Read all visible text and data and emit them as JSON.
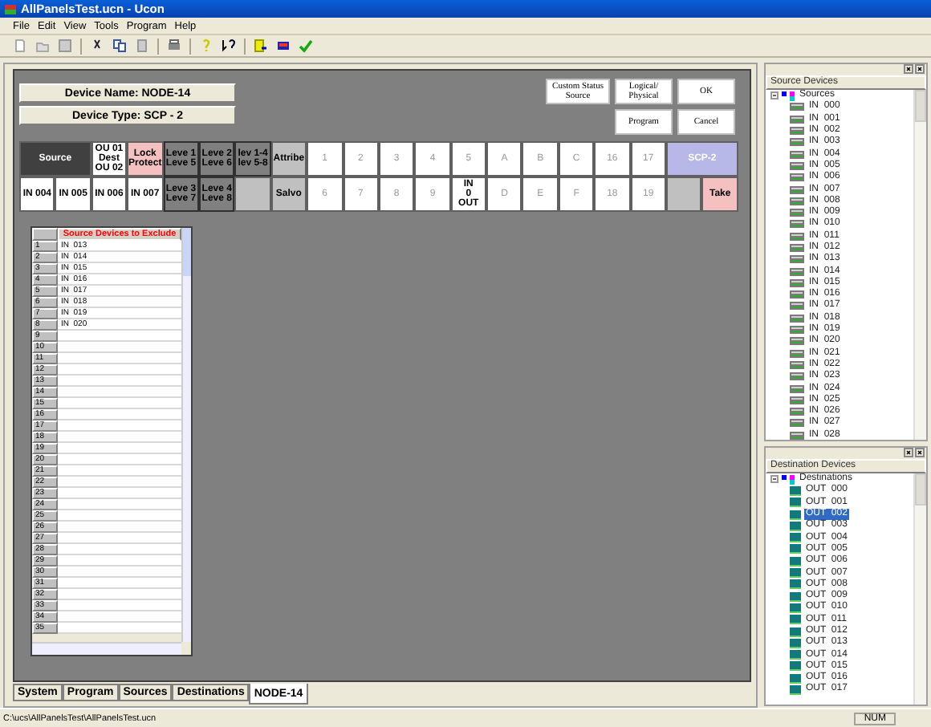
{
  "window": {
    "title": "AllPanelsTest.ucn - Ucon"
  },
  "menu": [
    "File",
    "Edit",
    "View",
    "Tools",
    "Program",
    "Help"
  ],
  "device": {
    "name": "Device Name: NODE-14",
    "type": "Device Type: SCP - 2"
  },
  "panel_buttons": [
    {
      "lines": [
        "Custom Status",
        "Source"
      ]
    },
    {
      "lines": [
        "Logical/",
        "Physical"
      ]
    },
    {
      "lines": [
        "OK"
      ]
    },
    {
      "lines": [
        "Program"
      ]
    },
    {
      "lines": [
        "Cancel"
      ]
    }
  ],
  "grid_rows": [
    [
      {
        "kind": "dark",
        "lines": [
          "Source"
        ]
      },
      {
        "kind": "white",
        "lines": [
          "OU 01",
          "Dest",
          "OU 02"
        ]
      },
      {
        "kind": "pink",
        "lines": [
          "Lock",
          "Protect"
        ]
      },
      {
        "kind": "level",
        "lines": [
          "Leve 1",
          "Leve 5"
        ]
      },
      {
        "kind": "level",
        "lines": [
          "Leve 2",
          "Leve 6"
        ]
      },
      {
        "kind": "level",
        "lines": [
          "lev 1-4",
          "lev 5-8"
        ]
      },
      {
        "kind": "action",
        "lines": [
          "Attribe"
        ]
      },
      {
        "kind": "key",
        "lines": [
          "1"
        ]
      },
      {
        "kind": "key",
        "lines": [
          "2"
        ]
      },
      {
        "kind": "key",
        "lines": [
          "3"
        ]
      },
      {
        "kind": "key",
        "lines": [
          "4"
        ]
      },
      {
        "kind": "key",
        "lines": [
          "5"
        ]
      },
      {
        "kind": "key",
        "lines": [
          "A"
        ]
      },
      {
        "kind": "key",
        "lines": [
          "B"
        ]
      },
      {
        "kind": "key",
        "lines": [
          "C"
        ]
      },
      {
        "kind": "key",
        "lines": [
          "16"
        ]
      },
      {
        "kind": "key",
        "lines": [
          "17"
        ]
      },
      {
        "kind": "device",
        "lines": [
          "SCP-2"
        ]
      }
    ],
    [
      {
        "kind": "white",
        "lines": [
          "IN 004"
        ]
      },
      {
        "kind": "white",
        "lines": [
          "IN 005"
        ]
      },
      {
        "kind": "white",
        "lines": [
          "IN 006"
        ]
      },
      {
        "kind": "white",
        "lines": [
          "IN 007"
        ]
      },
      {
        "kind": "level",
        "lines": [
          "Leve 3",
          "Leve 7"
        ]
      },
      {
        "kind": "level",
        "lines": [
          "Leve 4",
          "Leve 8"
        ]
      },
      {
        "kind": "blank"
      },
      {
        "kind": "action",
        "lines": [
          "Salvo"
        ]
      },
      {
        "kind": "key",
        "lines": [
          "6"
        ]
      },
      {
        "kind": "key",
        "lines": [
          "7"
        ]
      },
      {
        "kind": "key",
        "lines": [
          "8"
        ]
      },
      {
        "kind": "key",
        "lines": [
          "9"
        ]
      },
      {
        "kind": "white",
        "lines": [
          "IN",
          "0",
          "OUT"
        ]
      },
      {
        "kind": "key",
        "lines": [
          "D"
        ]
      },
      {
        "kind": "key",
        "lines": [
          "E"
        ]
      },
      {
        "kind": "key",
        "lines": [
          "F"
        ]
      },
      {
        "kind": "key",
        "lines": [
          "18"
        ]
      },
      {
        "kind": "key",
        "lines": [
          "19"
        ]
      },
      {
        "kind": "blank"
      },
      {
        "kind": "pink",
        "lines": [
          "Take"
        ]
      }
    ]
  ],
  "exclude_table": {
    "header": "Source Devices to Exclude",
    "rows": [
      {
        "number": "1",
        "value": "IN  013"
      },
      {
        "number": "2",
        "value": "IN  014"
      },
      {
        "number": "3",
        "value": "IN  015"
      },
      {
        "number": "4",
        "value": "IN  016"
      },
      {
        "number": "5",
        "value": "IN  017"
      },
      {
        "number": "6",
        "value": "IN  018"
      },
      {
        "number": "7",
        "value": "IN  019"
      },
      {
        "number": "8",
        "value": "IN  020"
      },
      {
        "number": "9"
      },
      {
        "number": "10"
      },
      {
        "number": "11"
      },
      {
        "number": "12"
      },
      {
        "number": "13"
      },
      {
        "number": "14"
      },
      {
        "number": "15"
      },
      {
        "number": "16"
      },
      {
        "number": "17"
      },
      {
        "number": "18"
      },
      {
        "number": "19"
      },
      {
        "number": "20"
      },
      {
        "number": "21"
      },
      {
        "number": "22"
      },
      {
        "number": "23"
      },
      {
        "number": "24"
      },
      {
        "number": "25"
      },
      {
        "number": "26"
      },
      {
        "number": "27"
      },
      {
        "number": "28"
      },
      {
        "number": "29"
      },
      {
        "number": "30"
      },
      {
        "number": "31"
      },
      {
        "number": "32"
      },
      {
        "number": "33"
      },
      {
        "number": "34"
      },
      {
        "number": "35"
      }
    ]
  },
  "doc_tabs": [
    {
      "label": "System",
      "selected": false
    },
    {
      "label": "Program",
      "selected": false
    },
    {
      "label": "Sources",
      "selected": false
    },
    {
      "label": "Destinations",
      "selected": false
    },
    {
      "label": "NODE-14",
      "selected": true
    }
  ],
  "source_panel": {
    "header": "Source Devices",
    "root": "Sources",
    "kind": "in",
    "items": [
      {
        "label": "IN  000",
        "selected": false
      },
      {
        "label": "IN  001",
        "selected": false
      },
      {
        "label": "IN  002",
        "selected": false
      },
      {
        "label": "IN  003",
        "selected": false
      },
      {
        "label": "IN  004",
        "selected": false
      },
      {
        "label": "IN  005",
        "selected": false
      },
      {
        "label": "IN  006",
        "selected": false
      },
      {
        "label": "IN  007",
        "selected": false
      },
      {
        "label": "IN  008",
        "selected": false
      },
      {
        "label": "IN  009",
        "selected": false
      },
      {
        "label": "IN  010",
        "selected": false
      },
      {
        "label": "IN  011",
        "selected": false
      },
      {
        "label": "IN  012",
        "selected": false
      },
      {
        "label": "IN  013",
        "selected": false
      },
      {
        "label": "IN  014",
        "selected": false
      },
      {
        "label": "IN  015",
        "selected": false
      },
      {
        "label": "IN  016",
        "selected": false
      },
      {
        "label": "IN  017",
        "selected": false
      },
      {
        "label": "IN  018",
        "selected": false
      },
      {
        "label": "IN  019",
        "selected": false
      },
      {
        "label": "IN  020",
        "selected": false
      },
      {
        "label": "IN  021",
        "selected": false
      },
      {
        "label": "IN  022",
        "selected": false
      },
      {
        "label": "IN  023",
        "selected": false
      },
      {
        "label": "IN  024",
        "selected": false
      },
      {
        "label": "IN  025",
        "selected": false
      },
      {
        "label": "IN  026",
        "selected": false
      },
      {
        "label": "IN  027",
        "selected": false
      },
      {
        "label": "IN  028",
        "selected": false
      }
    ]
  },
  "destination_panel": {
    "header": "Destination Devices",
    "root": "Destinations",
    "kind": "out",
    "items": [
      {
        "label": "OUT  000",
        "selected": false
      },
      {
        "label": "OUT  001",
        "selected": false
      },
      {
        "label": "OUT  002",
        "selected": true
      },
      {
        "label": "OUT  003",
        "selected": false
      },
      {
        "label": "OUT  004",
        "selected": false
      },
      {
        "label": "OUT  005",
        "selected": false
      },
      {
        "label": "OUT  006",
        "selected": false
      },
      {
        "label": "OUT  007",
        "selected": false
      },
      {
        "label": "OUT  008",
        "selected": false
      },
      {
        "label": "OUT  009",
        "selected": false
      },
      {
        "label": "OUT  010",
        "selected": false
      },
      {
        "label": "OUT  011",
        "selected": false
      },
      {
        "label": "OUT  012",
        "selected": false
      },
      {
        "label": "OUT  013",
        "selected": false
      },
      {
        "label": "OUT  014",
        "selected": false
      },
      {
        "label": "OUT  015",
        "selected": false
      },
      {
        "label": "OUT  016",
        "selected": false
      },
      {
        "label": "OUT  017",
        "selected": false
      }
    ]
  },
  "status_bar": {
    "path": "C:\\ucs\\AllPanelsTest\\AllPanelsTest.ucn",
    "indicator": "NUM"
  }
}
